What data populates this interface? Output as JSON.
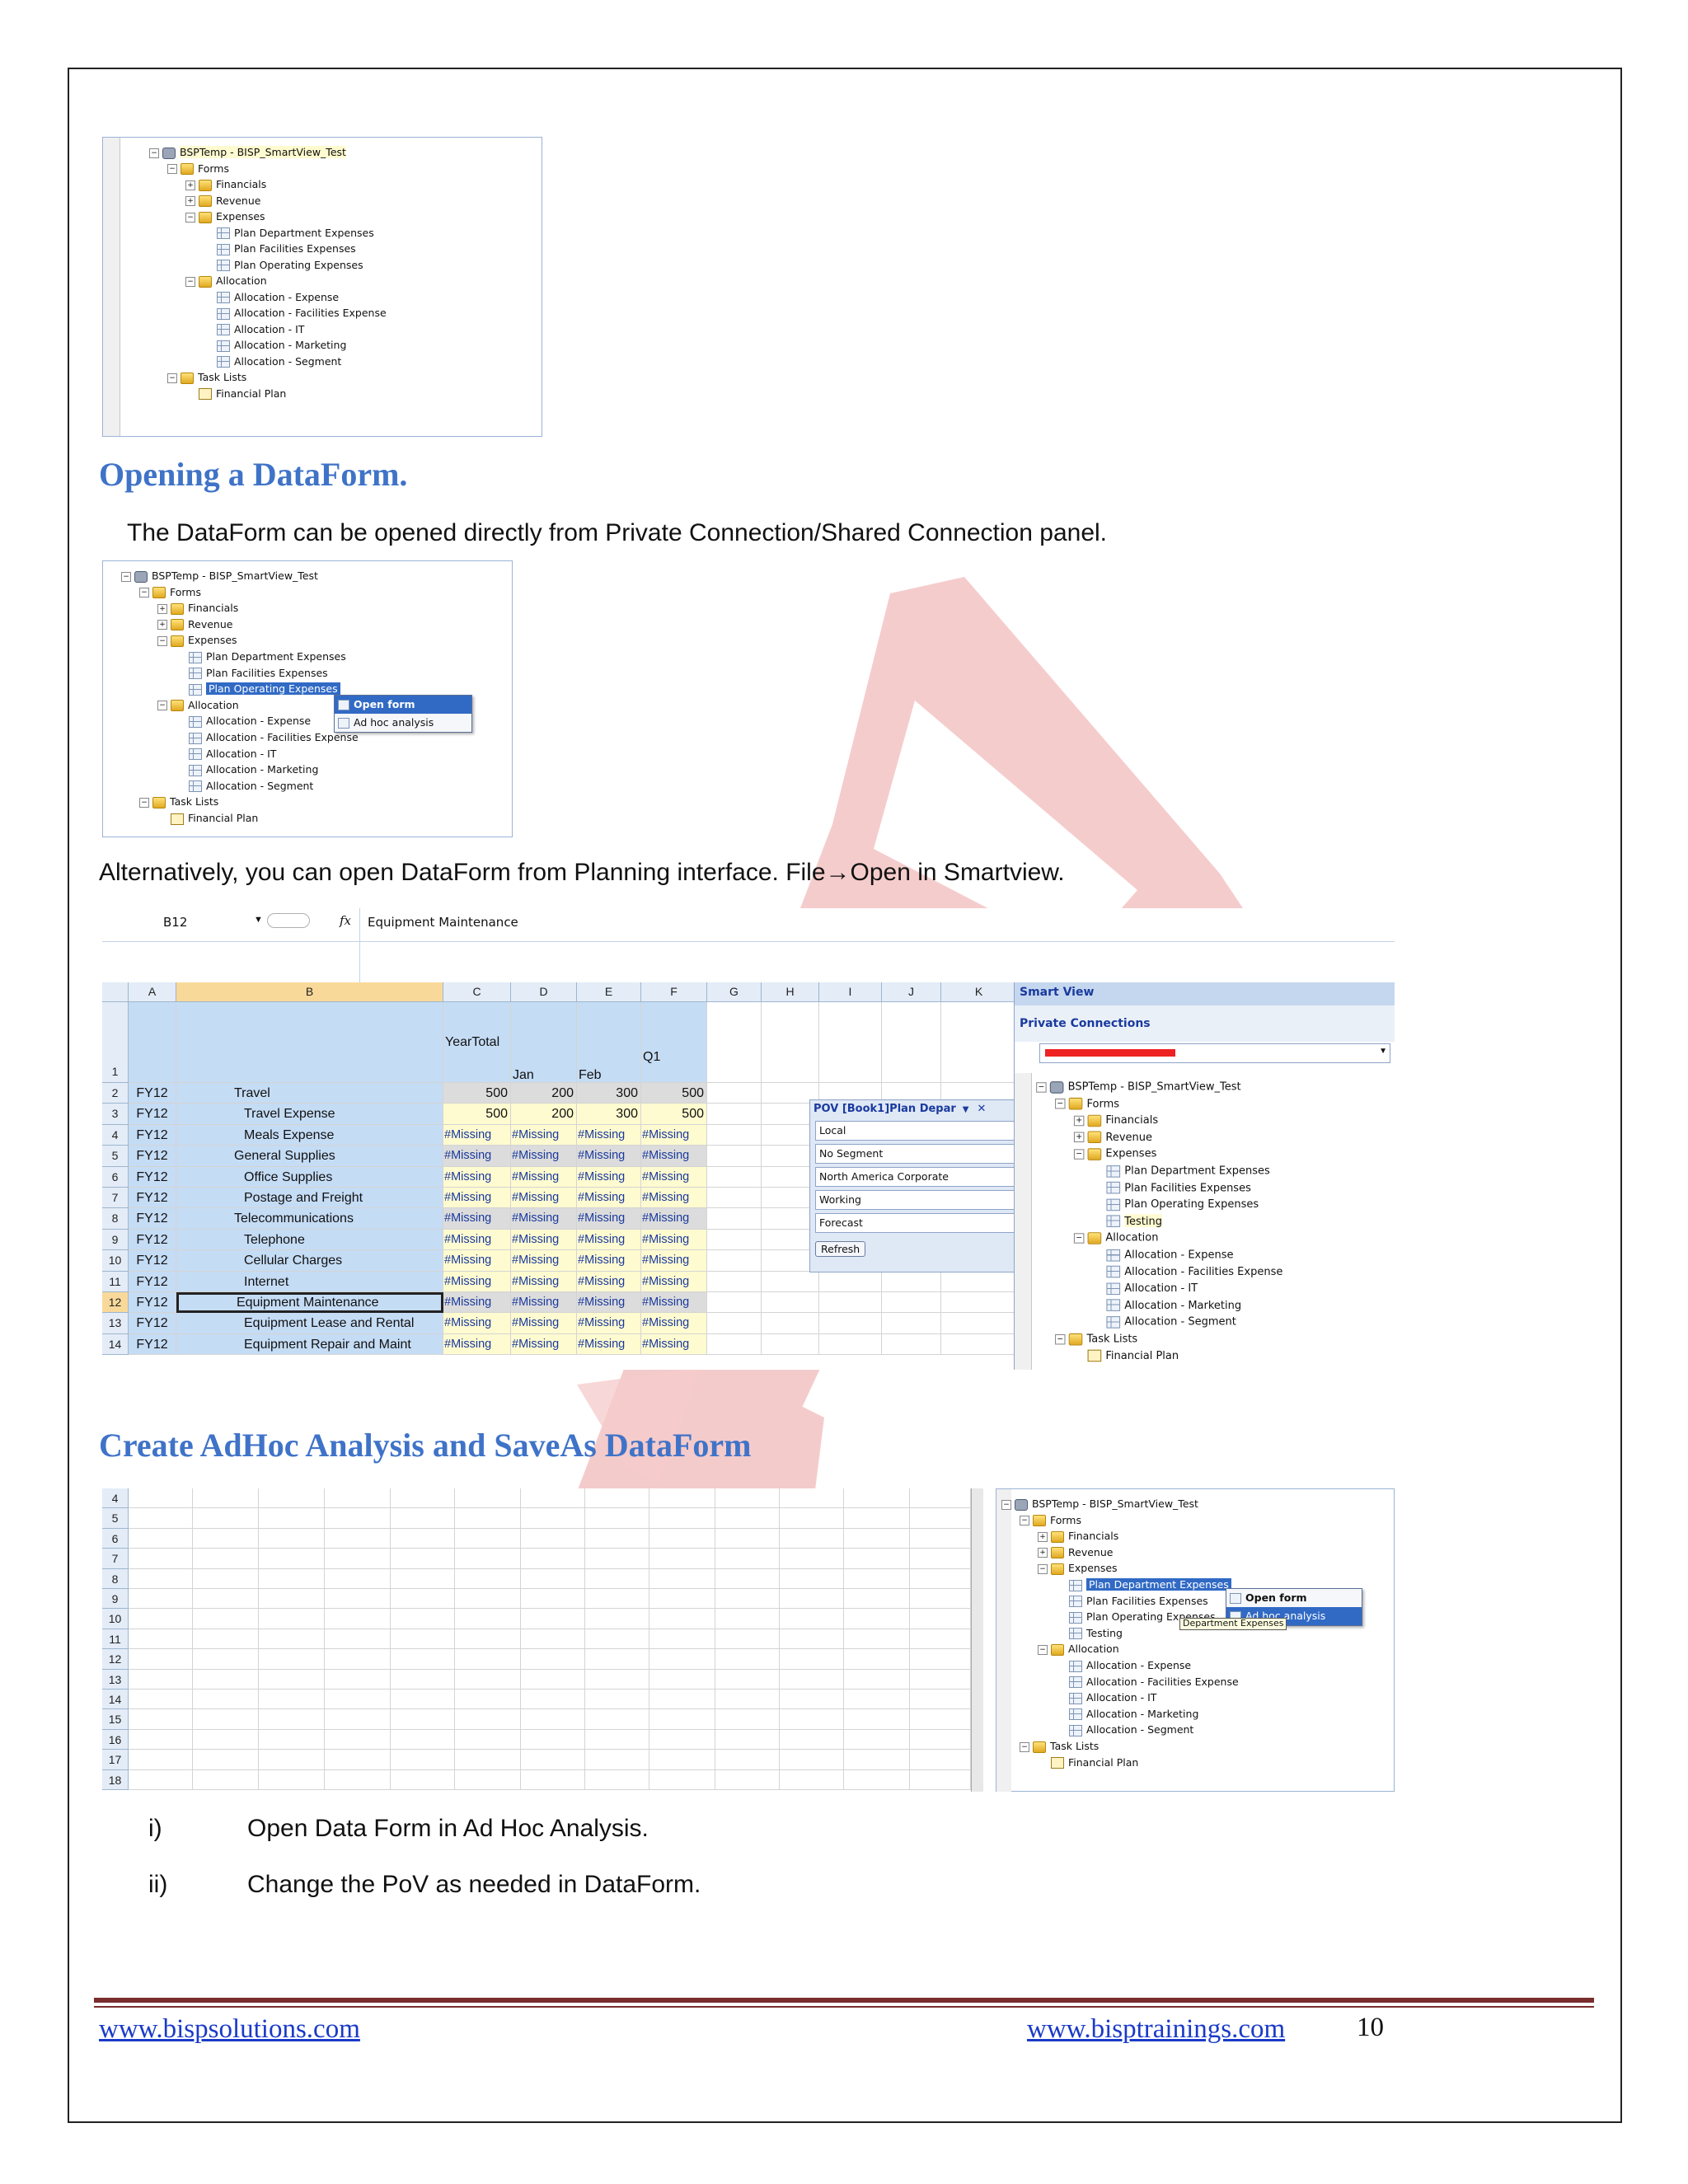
{
  "tree": {
    "root": "BSPTemp - BISP_SmartView_Test",
    "forms": "Forms",
    "financials": "Financials",
    "revenue": "Revenue",
    "expenses": "Expenses",
    "plan_dept": "Plan Department Expenses",
    "plan_fac": "Plan Facilities Expenses",
    "plan_op": "Plan Operating Expenses",
    "allocation": "Allocation",
    "alloc_exp": "Allocation - Expense",
    "alloc_fac": "Allocation - Facilities Expense",
    "alloc_it": "Allocation - IT",
    "alloc_mkt": "Allocation - Marketing",
    "alloc_seg": "Allocation - Segment",
    "task_lists": "Task Lists",
    "fin_plan": "Financial Plan",
    "testing": "Testing"
  },
  "section1": {
    "heading": "Opening a DataForm.",
    "text": "The DataForm can be opened directly from Private Connection/Shared Connection panel."
  },
  "context_menu": {
    "open_form": "Open form",
    "adhoc": "Ad hoc analysis",
    "tooltip": "Department Expenses"
  },
  "section2": {
    "text": "Alternatively, you can open DataForm from Planning interface. File→Open in Smartview."
  },
  "sheet": {
    "name_box": "B12",
    "fx": "fx",
    "formula": "Equipment Maintenance",
    "columns": [
      "A",
      "B",
      "C",
      "D",
      "E",
      "F",
      "G",
      "H",
      "I",
      "J",
      "K"
    ],
    "header_labels": {
      "yeartotal": "YearTotal",
      "jan": "Jan",
      "feb": "Feb",
      "q1": "Q1"
    },
    "rows": [
      {
        "num": "2",
        "year": "FY12",
        "name": "Travel",
        "indent": 1,
        "vals": [
          "500",
          "200",
          "300",
          "500"
        ]
      },
      {
        "num": "3",
        "year": "FY12",
        "name": "Travel Expense",
        "indent": 2,
        "vals": [
          "500",
          "200",
          "300",
          "500"
        ]
      },
      {
        "num": "4",
        "year": "FY12",
        "name": "Meals Expense",
        "indent": 2,
        "vals": [
          "#Missing",
          "#Missing",
          "#Missing",
          "#Missing"
        ]
      },
      {
        "num": "5",
        "year": "FY12",
        "name": "General Supplies",
        "indent": 1,
        "vals": [
          "#Missing",
          "#Missing",
          "#Missing",
          "#Missing"
        ]
      },
      {
        "num": "6",
        "year": "FY12",
        "name": "Office Supplies",
        "indent": 2,
        "vals": [
          "#Missing",
          "#Missing",
          "#Missing",
          "#Missing"
        ]
      },
      {
        "num": "7",
        "year": "FY12",
        "name": "Postage and Freight",
        "indent": 2,
        "vals": [
          "#Missing",
          "#Missing",
          "#Missing",
          "#Missing"
        ]
      },
      {
        "num": "8",
        "year": "FY12",
        "name": "Telecommunications",
        "indent": 1,
        "vals": [
          "#Missing",
          "#Missing",
          "#Missing",
          "#Missing"
        ]
      },
      {
        "num": "9",
        "year": "FY12",
        "name": "Telephone",
        "indent": 2,
        "vals": [
          "#Missing",
          "#Missing",
          "#Missing",
          "#Missing"
        ]
      },
      {
        "num": "10",
        "year": "FY12",
        "name": "Cellular Charges",
        "indent": 2,
        "vals": [
          "#Missing",
          "#Missing",
          "#Missing",
          "#Missing"
        ]
      },
      {
        "num": "11",
        "year": "FY12",
        "name": "Internet",
        "indent": 2,
        "vals": [
          "#Missing",
          "#Missing",
          "#Missing",
          "#Missing"
        ]
      },
      {
        "num": "12",
        "year": "FY12",
        "name": "Equipment Maintenance",
        "indent": 1,
        "vals": [
          "#Missing",
          "#Missing",
          "#Missing",
          "#Missing"
        ]
      },
      {
        "num": "13",
        "year": "FY12",
        "name": "Equipment Lease and Rental",
        "indent": 2,
        "vals": [
          "#Missing",
          "#Missing",
          "#Missing",
          "#Missing"
        ]
      },
      {
        "num": "14",
        "year": "FY12",
        "name": "Equipment Repair and Maint",
        "indent": 2,
        "vals": [
          "#Missing",
          "#Missing",
          "#Missing",
          "#Missing"
        ]
      }
    ]
  },
  "pov": {
    "title": "POV [Book1]Plan Depar",
    "selects": [
      "Local",
      "No Segment",
      "North America Corporate",
      "Working",
      "Forecast"
    ],
    "refresh": "Refresh"
  },
  "smartview": {
    "title": "Smart View",
    "private_connections": "Private Connections"
  },
  "section3": {
    "heading": "Create AdHoc Analysis and SaveAs DataForm",
    "row_numbers": [
      "4",
      "5",
      "6",
      "7",
      "8",
      "9",
      "10",
      "11",
      "12",
      "13",
      "14",
      "15",
      "16",
      "17",
      "18"
    ]
  },
  "steps": [
    {
      "num": "i)",
      "text": "Open Data Form  in Ad Hoc Analysis."
    },
    {
      "num": "ii)",
      "text": "Change the PoV as needed in DataForm."
    }
  ],
  "footer": {
    "left_link": "www.bispsolutions.com",
    "right_link": "www.bisptrainings.com",
    "page_number": "10"
  },
  "colors": {
    "heading": "#3f73c8",
    "link": "#1a3ac8",
    "watermark": "#e07a7a",
    "rule": "#7a2d2d"
  }
}
